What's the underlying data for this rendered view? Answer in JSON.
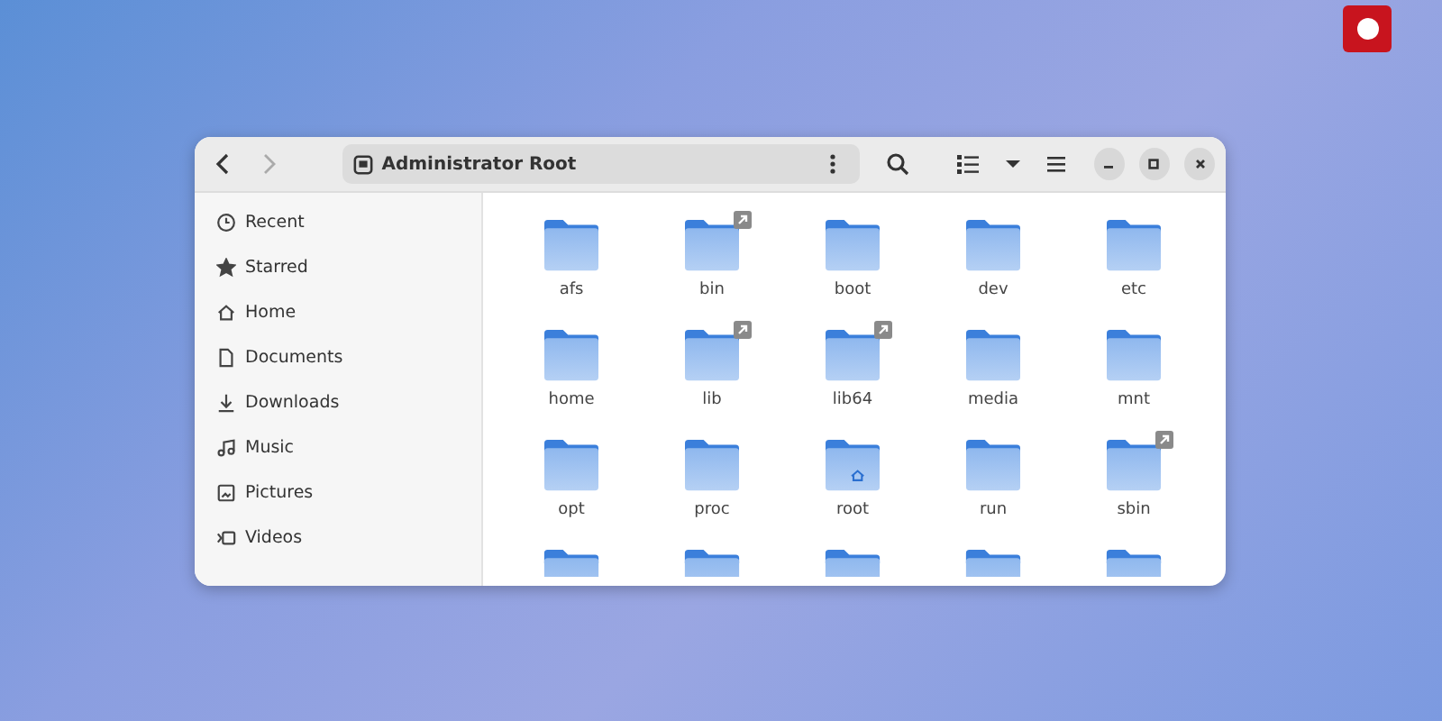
{
  "window": {
    "title": "Administrator Root"
  },
  "sidebar": {
    "items": [
      {
        "label": "Recent",
        "kind": "recent"
      },
      {
        "label": "Starred",
        "kind": "star"
      },
      {
        "label": "Home",
        "kind": "home"
      },
      {
        "label": "Documents",
        "kind": "document"
      },
      {
        "label": "Downloads",
        "kind": "download"
      },
      {
        "label": "Music",
        "kind": "music"
      },
      {
        "label": "Pictures",
        "kind": "picture"
      },
      {
        "label": "Videos",
        "kind": "video"
      }
    ]
  },
  "files": [
    {
      "name": "afs",
      "kind": "folder",
      "link": false
    },
    {
      "name": "bin",
      "kind": "folder",
      "link": true
    },
    {
      "name": "boot",
      "kind": "folder",
      "link": false
    },
    {
      "name": "dev",
      "kind": "folder",
      "link": false
    },
    {
      "name": "etc",
      "kind": "folder",
      "link": false
    },
    {
      "name": "home",
      "kind": "folder",
      "link": false
    },
    {
      "name": "lib",
      "kind": "folder",
      "link": true
    },
    {
      "name": "lib64",
      "kind": "folder",
      "link": true
    },
    {
      "name": "media",
      "kind": "folder",
      "link": false
    },
    {
      "name": "mnt",
      "kind": "folder",
      "link": false
    },
    {
      "name": "opt",
      "kind": "folder",
      "link": false
    },
    {
      "name": "proc",
      "kind": "folder",
      "link": false
    },
    {
      "name": "root",
      "kind": "home-folder",
      "link": false
    },
    {
      "name": "run",
      "kind": "folder",
      "link": false
    },
    {
      "name": "sbin",
      "kind": "folder",
      "link": true
    }
  ],
  "cut_off_files": [
    {
      "kind": "folder"
    },
    {
      "kind": "folder"
    },
    {
      "kind": "folder"
    },
    {
      "kind": "folder"
    },
    {
      "kind": "folder"
    }
  ]
}
